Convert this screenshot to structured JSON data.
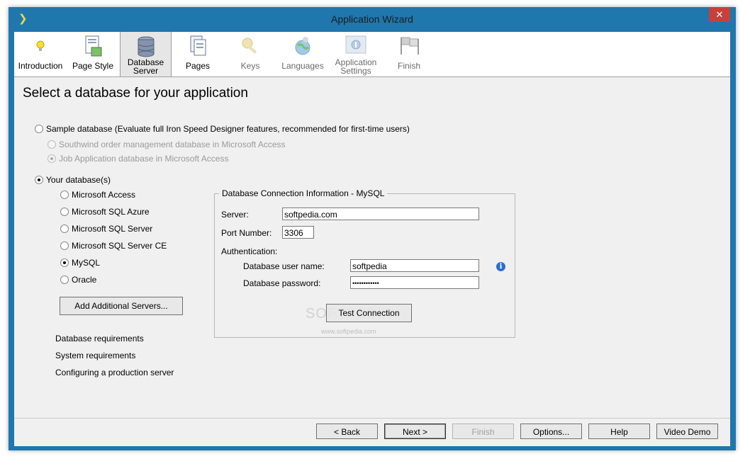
{
  "window": {
    "title": "Application Wizard",
    "close_glyph": "✕",
    "app_glyph": "❯"
  },
  "tabs": [
    {
      "label": "Introduction",
      "icon": "lightbulb-icon"
    },
    {
      "label": "Page Style",
      "icon": "page-style-icon"
    },
    {
      "label_line1": "Database",
      "label_line2": "Server",
      "icon": "database-icon"
    },
    {
      "label": "Pages",
      "icon": "pages-icon"
    },
    {
      "label": "Keys",
      "icon": "key-icon"
    },
    {
      "label": "Languages",
      "icon": "globe-icon"
    },
    {
      "label_line1": "Application",
      "label_line2": "Settings",
      "icon": "settings-icon"
    },
    {
      "label": "Finish",
      "icon": "checkered-flag-icon"
    }
  ],
  "heading": "Select a database for your application",
  "sample": {
    "label": "Sample database (Evaluate full Iron Speed Designer features, recommended for first-time users)",
    "options": [
      "Southwind order management database in Microsoft Access",
      "Job Application database in Microsoft Access"
    ]
  },
  "yours": {
    "label": "Your database(s)",
    "options": [
      "Microsoft Access",
      "Microsoft SQL Azure",
      "Microsoft SQL Server",
      "Microsoft SQL Server CE",
      "MySQL",
      "Oracle"
    ],
    "add_servers": "Add Additional Servers..."
  },
  "links": [
    "Database requirements",
    "System requirements",
    "Configuring a production server"
  ],
  "connection": {
    "title": "Database Connection Information - MySQL",
    "server_label": "Server:",
    "server_value": "softpedia.com",
    "port_label": "Port Number:",
    "port_value": "3306",
    "auth_label": "Authentication:",
    "user_label": "Database user name:",
    "user_value": "softpedia",
    "password_label": "Database password:",
    "password_value": "••••••••••••",
    "test_button": "Test Connection"
  },
  "watermark": {
    "text": "SOFTPEDIA",
    "url": "www.softpedia.com"
  },
  "buttons": {
    "back": "< Back",
    "next": "Next >",
    "finish": "Finish",
    "options": "Options...",
    "help": "Help",
    "video": "Video Demo"
  },
  "colors": {
    "frame": "#1f77ad",
    "close": "#c7413a",
    "info": "#2a6fc9"
  }
}
